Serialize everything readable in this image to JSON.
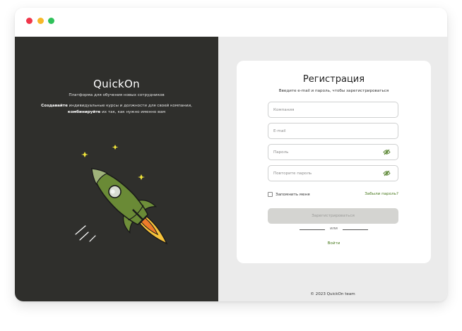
{
  "window": {
    "controls": [
      "close",
      "minimize",
      "maximize"
    ]
  },
  "left": {
    "brand": "QuickOn",
    "tagline": "Платформа для обучения новых сотрудников",
    "desc_bold1": "Создавайте",
    "desc_text1": " индивидуальные курсы и должности для своей компании,",
    "desc_bold2": "комбинируйте",
    "desc_text2": " их так, как нужно именно вам",
    "illustration": "rocket-icon"
  },
  "form": {
    "title": "Регистрация",
    "subtitle": "Введите e-mail и пароль, чтобы зарегистрироваться",
    "company_placeholder": "Компания",
    "email_placeholder": "E-mail",
    "password_placeholder": "Пароль",
    "repeat_password_placeholder": "Повторите пароль",
    "remember_label": "Запомнить меня",
    "forgot_label": "Забыли пароль?",
    "submit_label": "Зарегистрироваться",
    "or_label": "или",
    "login_label": "Войти"
  },
  "footer": {
    "text": "© 2023 QuickOn team"
  },
  "colors": {
    "sidebar_bg": "#2f2f2c",
    "panel_bg": "#ebebeb",
    "accent_green": "#4a7a1f",
    "close_dot": "#f0364a",
    "minimize_dot": "#f7b829",
    "maximize_dot": "#2fc15a",
    "submit_disabled": "#d4d4d1"
  }
}
